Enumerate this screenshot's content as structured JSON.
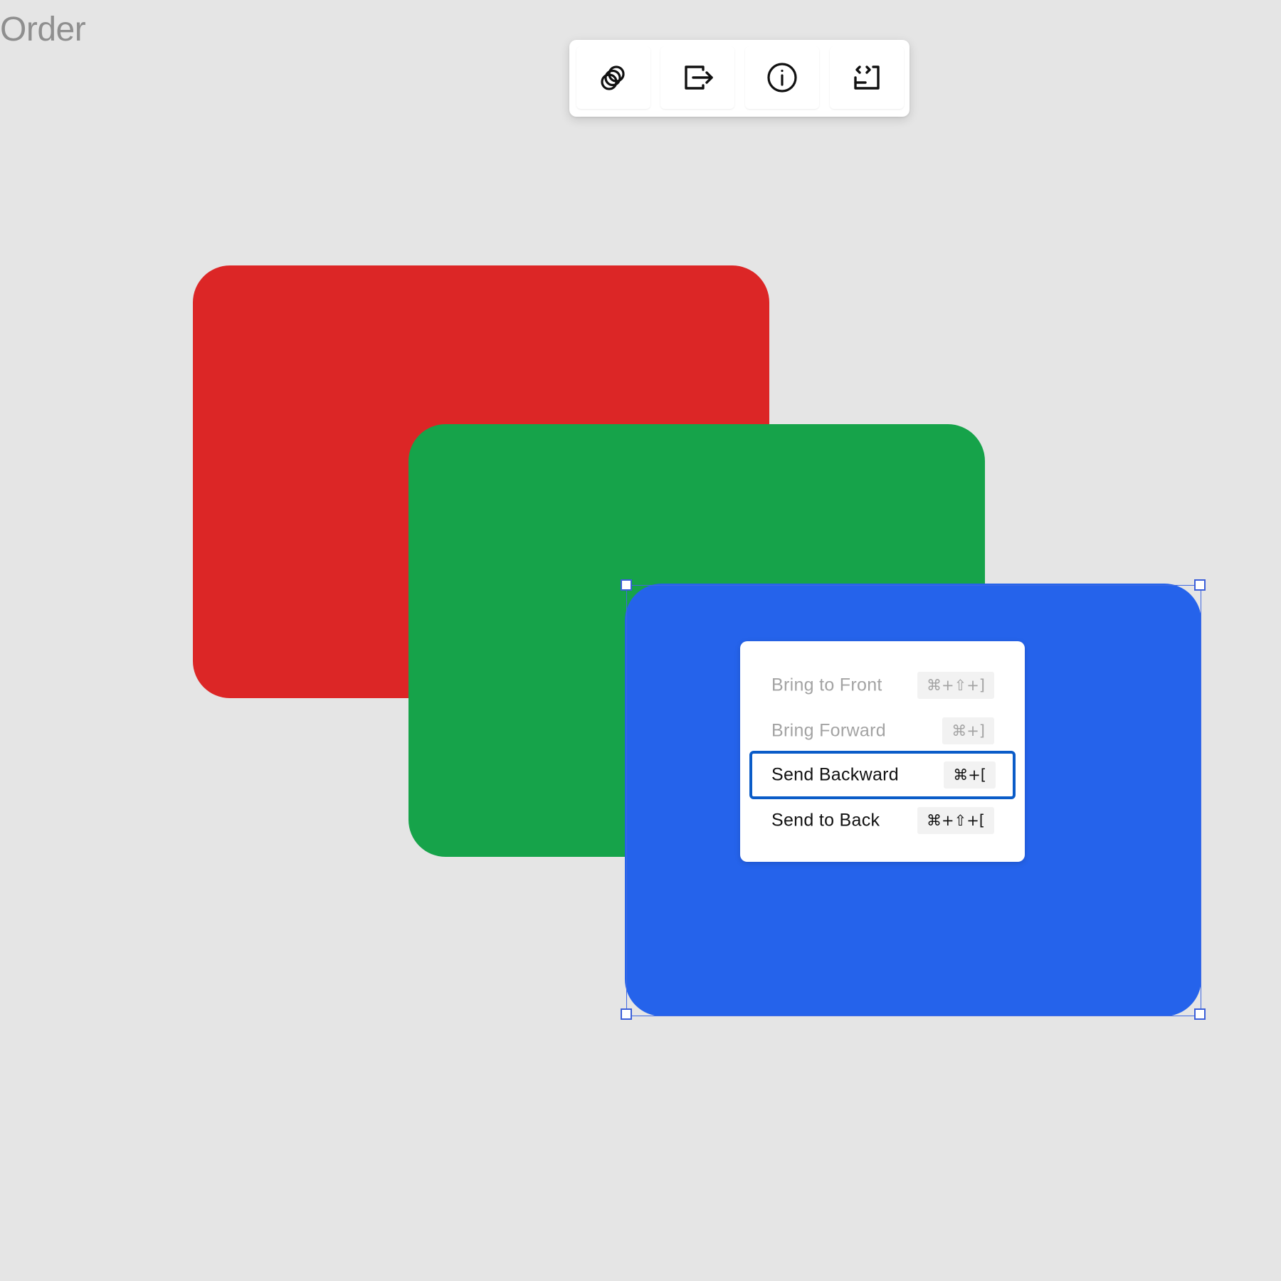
{
  "page": {
    "title": "Order"
  },
  "toolbar": {
    "buttons": [
      {
        "icon": "layers-icon"
      },
      {
        "icon": "export-icon"
      },
      {
        "icon": "info-icon"
      },
      {
        "icon": "code-icon"
      }
    ]
  },
  "canvas": {
    "background": "#e5e5e5",
    "shapes": [
      {
        "name": "red-rectangle",
        "color": "#dc2626"
      },
      {
        "name": "green-rectangle",
        "color": "#16a34a"
      },
      {
        "name": "blue-rectangle",
        "color": "#2563eb",
        "selected": true
      }
    ]
  },
  "context_menu": {
    "items": [
      {
        "label": "Bring to Front",
        "shortcut": "⌘+⇧+]",
        "disabled": true
      },
      {
        "label": "Bring Forward",
        "shortcut": "⌘+]",
        "disabled": true
      },
      {
        "label": "Send Backward",
        "shortcut": "⌘+[",
        "active": true
      },
      {
        "label": "Send to Back",
        "shortcut": "⌘+⇧+["
      }
    ]
  },
  "colors": {
    "selection": "#4169e1",
    "focus_ring": "#0b5cc8"
  }
}
